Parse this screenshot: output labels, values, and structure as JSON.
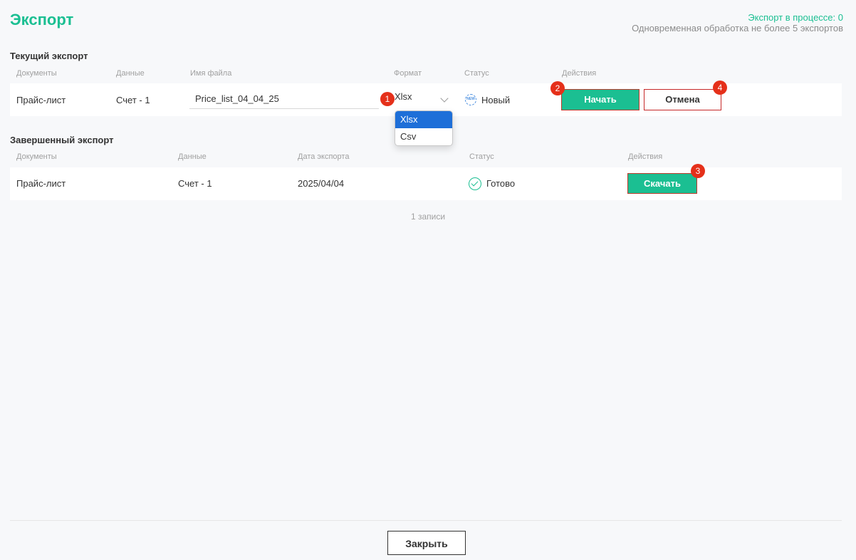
{
  "header": {
    "title": "Экспорт",
    "in_progress": "Экспорт в процессе: 0",
    "limit_note": "Одновременная обработка не более 5 экспортов"
  },
  "current": {
    "section_title": "Текущий экспорт",
    "columns": [
      "Документы",
      "Данные",
      "Имя файла",
      "Формат",
      "Статус",
      "Действия"
    ],
    "row": {
      "document": "Прайс-лист",
      "data": "Счет - 1",
      "filename": "Price_list_04_04_25",
      "format": "Xlsx",
      "status_icon_text": "NEW",
      "status": "Новый",
      "start_label": "Начать",
      "cancel_label": "Отмена"
    },
    "format_options": [
      "Xlsx",
      "Csv"
    ]
  },
  "completed": {
    "section_title": "Завершенный экспорт",
    "columns": [
      "Документы",
      "Данные",
      "Дата экспорта",
      "Статус",
      "Действия"
    ],
    "row": {
      "document": "Прайс-лист",
      "data": "Счет - 1",
      "date": "2025/04/04",
      "status": "Готово",
      "download_label": "Скачать"
    },
    "records": "1 записи"
  },
  "badges": [
    "1",
    "2",
    "3",
    "4"
  ],
  "footer": {
    "close_label": "Закрыть"
  },
  "colors": {
    "accent": "#1bbf92",
    "badge": "#e5301a",
    "selected": "#1e6fd8"
  }
}
